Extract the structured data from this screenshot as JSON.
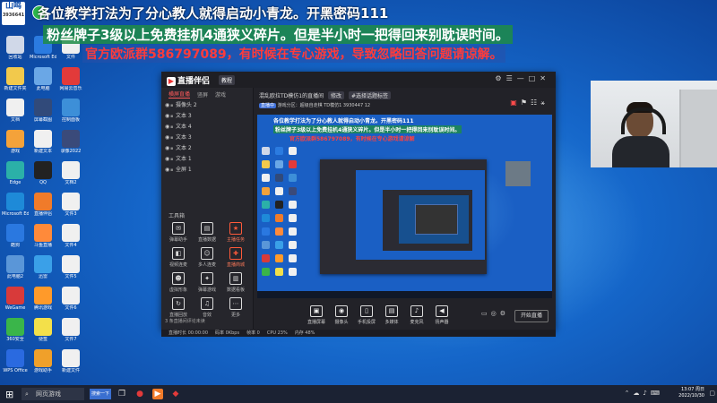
{
  "overlay": {
    "line1": "各位教学打法为了分心教人就得启动小青龙。开黑密码111",
    "line2": "粉丝牌子3级以上免费挂机4通狭义碎片。但是半小时一把得回来别耽误时间。",
    "line3": "官方欧派群586797089，有时候在专心游戏，导致忽略回答问题请谅解。",
    "logo_text": "山鸣",
    "logo_sub": "3936641"
  },
  "desktop_icons": [
    {
      "label": "回收站",
      "icon": "recycle-bin-icon",
      "color": "#d0d8e8"
    },
    {
      "label": "Microsoft Edge",
      "icon": "edge-icon",
      "color": "#2b7be0"
    },
    {
      "label": "文件",
      "icon": "file-icon",
      "color": "#f0f0f0"
    },
    {
      "label": "新建文件夹",
      "icon": "folder-icon",
      "color": "#f2c94c"
    },
    {
      "label": "此电脑",
      "icon": "computer-icon",
      "color": "#6aa7e6"
    },
    {
      "label": "网易云音乐",
      "icon": "music-icon",
      "color": "#e23a3a"
    },
    {
      "label": "文档",
      "icon": "doc-icon",
      "color": "#f0f0f0"
    },
    {
      "label": "屏幕截图",
      "icon": "image-icon",
      "color": "#314a7a"
    },
    {
      "label": "控制面板",
      "icon": "control-icon",
      "color": "#3d8fd8"
    },
    {
      "label": "游戏",
      "icon": "game-icon",
      "color": "#f4a23a"
    },
    {
      "label": "新建文本",
      "icon": "file-icon",
      "color": "#f0f0f0"
    },
    {
      "label": "录像2022",
      "icon": "video-icon",
      "color": "#3a4a7a"
    },
    {
      "label": "Edge",
      "icon": "edge-icon",
      "color": "#2bb0a8"
    },
    {
      "label": "QQ",
      "icon": "qq-icon",
      "color": "#222"
    },
    {
      "label": "文档2",
      "icon": "file-icon",
      "color": "#f0f0f0"
    },
    {
      "label": "Microsoft Edge",
      "icon": "edge-icon",
      "color": "#1e8ad8"
    },
    {
      "label": "直播伴侣",
      "icon": "live-icon",
      "color": "#f07b2a"
    },
    {
      "label": "文件3",
      "icon": "file-icon",
      "color": "#f0f0f0"
    },
    {
      "label": "酷狗",
      "icon": "kugou-icon",
      "color": "#2a78e0"
    },
    {
      "label": "斗鱼直播",
      "icon": "douyu-icon",
      "color": "#ff8a3a"
    },
    {
      "label": "文件4",
      "icon": "file-icon",
      "color": "#f0f0f0"
    },
    {
      "label": "此电脑2",
      "icon": "computer-icon",
      "color": "#5a96d8"
    },
    {
      "label": "迅雷",
      "icon": "xunlei-icon",
      "color": "#3aa0e8"
    },
    {
      "label": "文件5",
      "icon": "file-icon",
      "color": "#f0f0f0"
    },
    {
      "label": "WeGame",
      "icon": "wegame-icon",
      "color": "#d83a3a"
    },
    {
      "label": "腾讯游戏",
      "icon": "tencent-icon",
      "color": "#ff9a2a"
    },
    {
      "label": "文件6",
      "icon": "file-icon",
      "color": "#f0f0f0"
    },
    {
      "label": "360安全",
      "icon": "security-icon",
      "color": "#3ab54a"
    },
    {
      "label": "便签",
      "icon": "note-icon",
      "color": "#f3e04a"
    },
    {
      "label": "文件7",
      "icon": "file-icon",
      "color": "#f0f0f0"
    },
    {
      "label": "WPS Office",
      "icon": "wps-icon",
      "color": "#2a6ae0"
    },
    {
      "label": "游戏助手",
      "icon": "game-icon",
      "color": "#f0a02a"
    },
    {
      "label": "新建文件",
      "icon": "file-icon",
      "color": "#f0f0f0"
    }
  ],
  "app": {
    "name": "直播伴侣",
    "tag": "教程",
    "scene_tabs": [
      "横屏直播",
      "竖屏",
      "游戏"
    ],
    "sources": [
      "摄像头 2",
      "文本 3",
      "文本 4",
      "文本 3",
      "文本 2",
      "文本 1",
      "全屏 1"
    ],
    "tools_title": "工具箱",
    "tools": [
      {
        "label": "弹幕助手",
        "icon": "danmu-icon",
        "hot": false
      },
      {
        "label": "直播数据",
        "icon": "data-icon",
        "hot": false
      },
      {
        "label": "主播任务",
        "icon": "task-icon",
        "hot": true
      },
      {
        "label": "视频连麦",
        "icon": "video-call-icon",
        "hot": false
      },
      {
        "label": "多人连麦",
        "icon": "multi-call-icon",
        "hot": false
      },
      {
        "label": "直播商城",
        "icon": "shop-icon",
        "hot": true
      },
      {
        "label": "虚拟形象",
        "icon": "avatar-icon",
        "hot": false
      },
      {
        "label": "弹幕游戏",
        "icon": "danmu-game-icon",
        "hot": false
      },
      {
        "label": "数据看板",
        "icon": "dashboard-icon",
        "hot": false
      },
      {
        "label": "直播回放",
        "icon": "replay-icon",
        "hot": false
      },
      {
        "label": "音效",
        "icon": "sound-icon",
        "hot": false
      },
      {
        "label": "更多",
        "icon": "more-icon",
        "hot": false
      }
    ],
    "notice": "3 条直播间评论未读",
    "room_title": "混乱欧拉TD模仿1的直播间",
    "room_btn1": "修改",
    "room_btn2": "#选择话题标签",
    "room_status": "直播中",
    "room_info": "游戏分区：超级自走棋  TD模仿1  3930447  12",
    "preview": {
      "line1": "各位教学打法为了分心教人就得启动小青龙。开黑密码111",
      "line2": "粉丝牌子3级以上免费挂机4通狭义碎片。但是半小时一把得回来别耽误时间。",
      "line3": "官方欧派群586797089，有时候在专心游戏请谅解"
    },
    "controls": [
      {
        "label": "直播屏幕",
        "icon": "screen-icon"
      },
      {
        "label": "摄像头",
        "icon": "camera-icon"
      },
      {
        "label": "手机投屏",
        "icon": "phone-cast-icon"
      },
      {
        "label": "多媒体",
        "icon": "media-icon"
      },
      {
        "label": "麦克风",
        "icon": "mic-icon"
      },
      {
        "label": "扬声器",
        "icon": "speaker-icon"
      }
    ],
    "start_label": "开始直播",
    "status": [
      "直播时长 00:00:00",
      "码率 0Kbps",
      "帧率 0",
      "CPU 23%",
      "内存 48%"
    ]
  },
  "taskbar": {
    "search_placeholder": "网页游戏",
    "active_item": "搜索一下",
    "clock_time": "13:07 周日",
    "clock_date": "2022/10/30"
  }
}
